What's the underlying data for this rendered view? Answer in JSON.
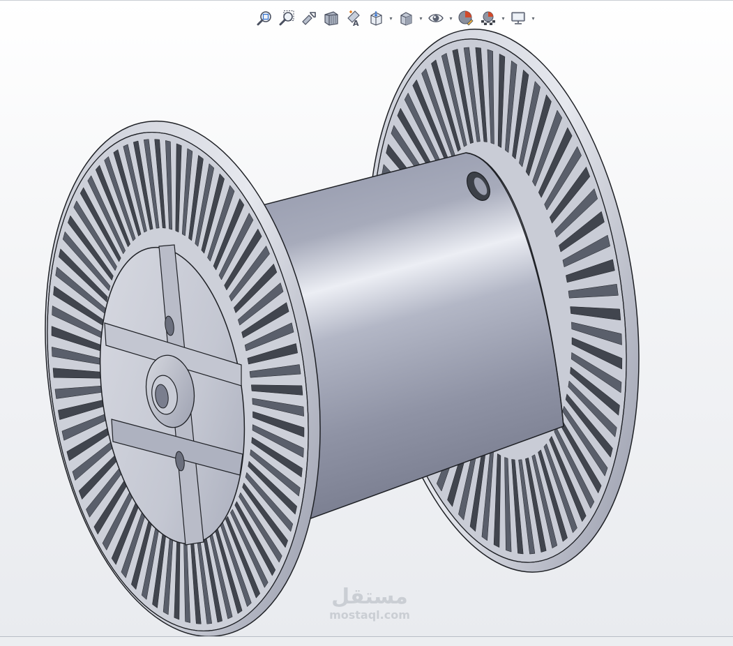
{
  "viewport": {
    "background_top": "#ffffff",
    "background_bottom": "#e9ebef"
  },
  "toolbar": {
    "buttons": [
      {
        "id": "zoom-to-fit",
        "icon": "zoom-to-fit-icon",
        "dropdown": false
      },
      {
        "id": "zoom-to-area",
        "icon": "zoom-to-area-icon",
        "dropdown": false
      },
      {
        "id": "previous-view",
        "icon": "previous-view-icon",
        "dropdown": false
      },
      {
        "id": "section-view",
        "icon": "section-view-icon",
        "dropdown": false
      },
      {
        "id": "dynamic-annotation",
        "icon": "dynamic-annotation-icon",
        "dropdown": false
      },
      {
        "id": "view-orientation",
        "icon": "view-orientation-icon",
        "dropdown": true
      },
      {
        "id": "display-style",
        "icon": "display-style-icon",
        "dropdown": true
      },
      {
        "id": "hide-show-items",
        "icon": "hide-show-items-icon",
        "dropdown": true
      },
      {
        "id": "edit-appearance",
        "icon": "edit-appearance-icon",
        "dropdown": false
      },
      {
        "id": "apply-scene",
        "icon": "apply-scene-icon",
        "dropdown": true
      },
      {
        "id": "view-settings",
        "icon": "view-settings-icon",
        "dropdown": true
      }
    ]
  },
  "model": {
    "name": "cable-drum-spool",
    "body_color": "#9ea3b4",
    "highlight_color": "#e9ebf2",
    "edge_color": "#1e2025",
    "slot_dark_color": "#3c4048"
  },
  "watermark": {
    "arabic": "مستقل",
    "latin": "mostaql.com"
  }
}
